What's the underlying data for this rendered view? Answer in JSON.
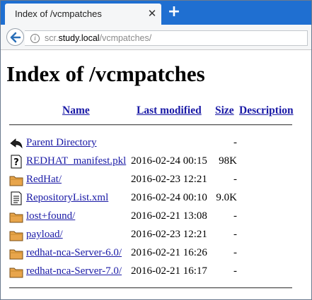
{
  "browser": {
    "tab_title": "Index of /vcmpatches",
    "tab_close": "✕",
    "new_tab": "+",
    "url_prefix": "scr.",
    "url_host": "study.local",
    "url_path": "/vcmpatches/"
  },
  "page": {
    "title": "Index of /vcmpatches",
    "columns": {
      "name": "Name",
      "last_modified": "Last modified",
      "size": "Size",
      "description": "Description"
    },
    "rows": [
      {
        "icon": "back-icon",
        "name": "Parent Directory",
        "date": "",
        "size": "-"
      },
      {
        "icon": "unknown-file-icon",
        "name": "REDHAT_manifest.pkl",
        "date": "2016-02-24 00:15",
        "size": "98K"
      },
      {
        "icon": "folder-icon",
        "name": "RedHat/",
        "date": "2016-02-23 12:21",
        "size": "-"
      },
      {
        "icon": "text-file-icon",
        "name": "RepositoryList.xml",
        "date": "2016-02-24 00:10",
        "size": "9.0K"
      },
      {
        "icon": "folder-icon",
        "name": "lost+found/",
        "date": "2016-02-21 13:08",
        "size": "-"
      },
      {
        "icon": "folder-icon",
        "name": "payload/",
        "date": "2016-02-23 12:21",
        "size": "-"
      },
      {
        "icon": "folder-icon",
        "name": "redhat-nca-Server-6.0/",
        "date": "2016-02-21 16:26",
        "size": "-"
      },
      {
        "icon": "folder-icon",
        "name": "redhat-nca-Server-7.0/",
        "date": "2016-02-21 16:17",
        "size": "-"
      }
    ]
  }
}
